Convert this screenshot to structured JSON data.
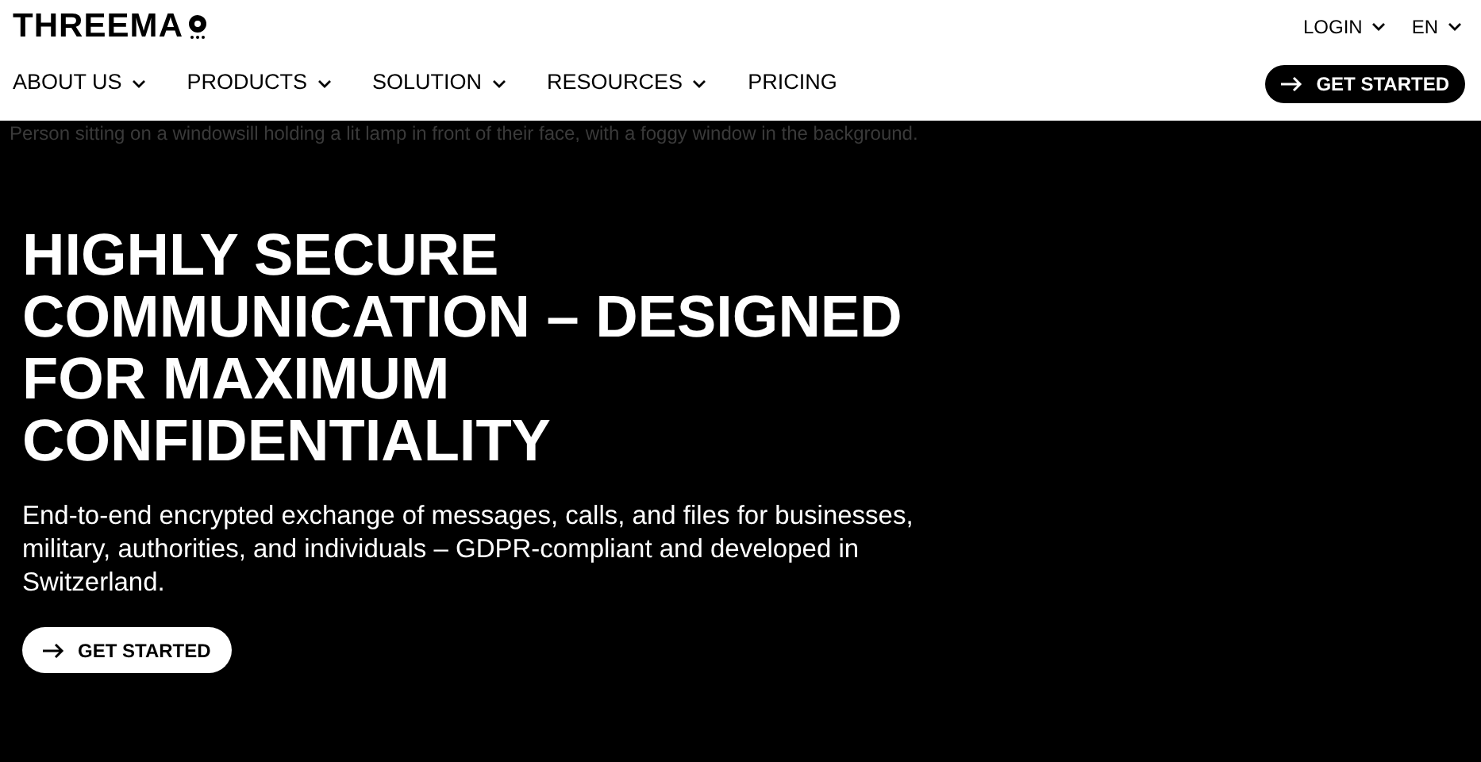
{
  "header": {
    "logo": "THREEMA",
    "top_links": [
      {
        "label": "LOGIN"
      },
      {
        "label": "EN"
      }
    ],
    "nav": [
      {
        "label": "ABOUT US",
        "dropdown": true
      },
      {
        "label": "PRODUCTS",
        "dropdown": true
      },
      {
        "label": "SOLUTION",
        "dropdown": true
      },
      {
        "label": "RESOURCES",
        "dropdown": true
      },
      {
        "label": "PRICING",
        "dropdown": false
      }
    ],
    "cta": "GET STARTED"
  },
  "hero": {
    "image_alt": "Person sitting on a windowsill holding a lit lamp in front of their face, with a foggy window in the background.",
    "title": "HIGHLY SECURE COMMUNICATION – DESIGNED FOR MAXIMUM CONFIDENTIALITY",
    "text": "End-to-end encrypted exchange of messages, calls, and files for businesses, military, authorities, and individuals – GDPR-compliant and developed in Switzerland.",
    "cta": "GET STARTED"
  }
}
